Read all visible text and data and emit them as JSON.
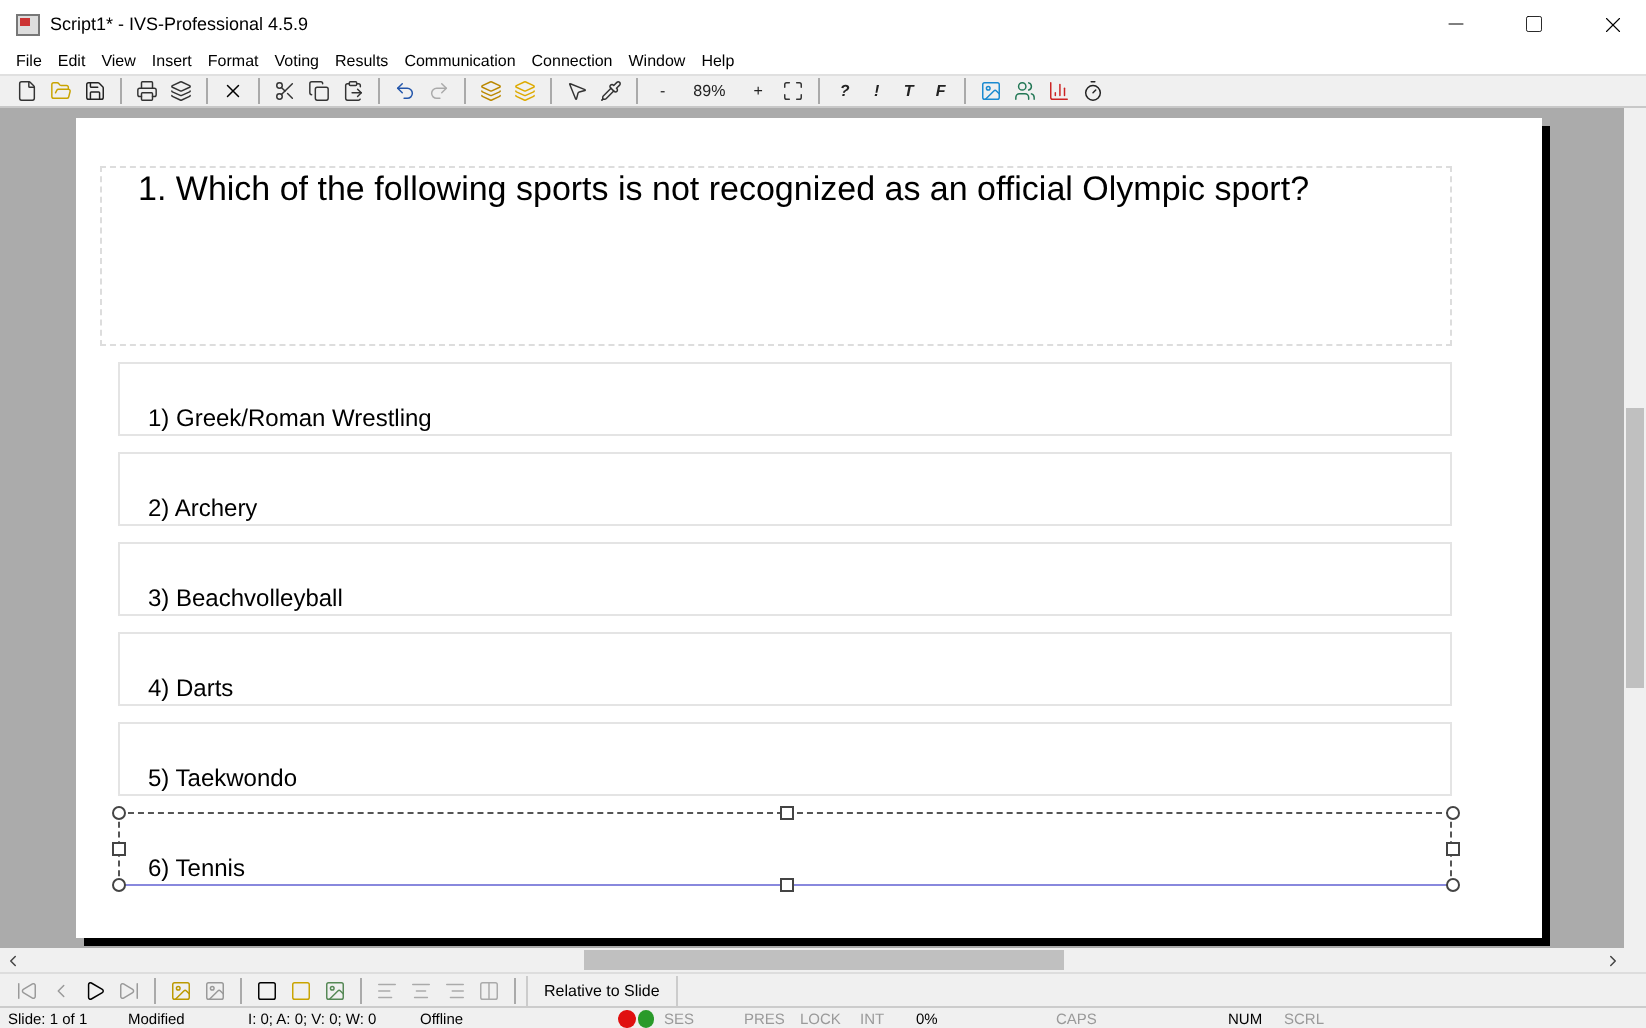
{
  "window": {
    "title": "Script1* - IVS-Professional 4.5.9"
  },
  "menu": [
    "File",
    "Edit",
    "View",
    "Insert",
    "Format",
    "Voting",
    "Results",
    "Communication",
    "Connection",
    "Window",
    "Help"
  ],
  "toolbar": {
    "zoom_out": "-",
    "zoom": "89%",
    "zoom_in": "+",
    "answer_marks": [
      "?",
      "!",
      "T",
      "F"
    ]
  },
  "slide": {
    "question": "1. Which of the following sports is not recognized as an official Olympic sport?",
    "answers": [
      {
        "text": "1) Greek/Roman Wrestling",
        "selected": false
      },
      {
        "text": "2) Archery",
        "selected": false
      },
      {
        "text": "3) Beachvolleyball",
        "selected": false
      },
      {
        "text": "4) Darts",
        "selected": false
      },
      {
        "text": "5) Taekwondo",
        "selected": false
      },
      {
        "text": "6) Tennis",
        "selected": true
      }
    ]
  },
  "bottom_toolbar": {
    "button": "Relative to Slide"
  },
  "status_bar": [
    {
      "text": "Slide: 1 of 1",
      "disabled": false
    },
    {
      "text": "Modified",
      "disabled": false
    },
    {
      "text": "I: 0;  A: 0;  V: 0;  W: 0",
      "disabled": false
    },
    {
      "text": "Offline",
      "disabled": false
    },
    {
      "text": "SES",
      "disabled": true
    },
    {
      "text": "PRES",
      "disabled": true
    },
    {
      "text": "LOCK",
      "disabled": true
    },
    {
      "text": "INT",
      "disabled": true
    },
    {
      "text": "0%",
      "disabled": false
    },
    {
      "text": "CAPS",
      "disabled": true
    },
    {
      "text": "NUM",
      "disabled": false
    },
    {
      "text": "SCRL",
      "disabled": true
    }
  ]
}
